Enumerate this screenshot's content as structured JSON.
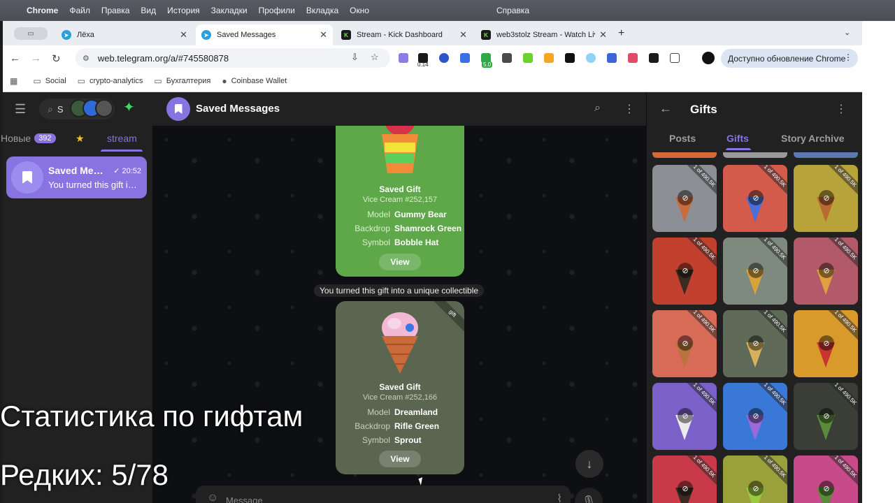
{
  "menubar": {
    "app": "Chrome",
    "items": [
      "Файл",
      "Правка",
      "Вид",
      "История",
      "Закладки",
      "Профили",
      "Вкладка",
      "Окно"
    ],
    "help": "Справка"
  },
  "browser": {
    "tabs": [
      {
        "title": "Лёха",
        "favicon": "telegram-icon"
      },
      {
        "title": "Saved Messages",
        "favicon": "telegram-icon"
      },
      {
        "title": "Stream - Kick Dashboard",
        "favicon": "kick-icon"
      },
      {
        "title": "web3stolz Stream - Watch Live",
        "favicon": "kick-icon"
      }
    ],
    "url": "web.telegram.org/a/#745580878",
    "extension_badges": [
      "0.14",
      "5.0"
    ],
    "update_button": "Доступно обновление Chrome",
    "bookmarks": [
      "Social",
      "crypto-analytics",
      "Бухгалтерия",
      "Coinbase Wallet"
    ]
  },
  "sidebar": {
    "search_value": "S",
    "folders": [
      {
        "label": "Новые",
        "badge": "392"
      },
      {
        "label": "★"
      },
      {
        "label": "stream"
      }
    ],
    "chat": {
      "name": "Saved Messages",
      "time": "20:52",
      "preview": "You turned this gift into a unique collectible"
    }
  },
  "chat": {
    "title": "Saved Messages",
    "service_message": "You turned this gift into a unique collectible",
    "composer_placeholder": "Message",
    "cards": [
      {
        "title": "Saved Gift",
        "subtitle": "Vice Cream #252,157",
        "model": "Gummy Bear",
        "backdrop": "Shamrock Green",
        "symbol": "Bobble Hat",
        "view": "View",
        "label_model": "Model",
        "label_backdrop": "Backdrop",
        "label_symbol": "Symbol",
        "accent": "#5fa84a"
      },
      {
        "title": "Saved Gift",
        "subtitle": "Vice Cream #252,166",
        "model": "Dreamland",
        "backdrop": "Rifle Green",
        "symbol": "Sprout",
        "view": "View",
        "ribbon": "gift",
        "label_model": "Model",
        "label_backdrop": "Backdrop",
        "label_symbol": "Symbol",
        "accent": "#5a6650"
      }
    ]
  },
  "gifts_panel": {
    "title": "Gifts",
    "tabs": [
      "Posts",
      "Gifts",
      "Story Archive"
    ],
    "ribbon_text": "1 of 490.5K",
    "tiles": [
      {
        "bg": "#8c8f96",
        "cone": "#c96b3a"
      },
      {
        "bg": "#d45a4c",
        "cone": "#4b6fd6"
      },
      {
        "bg": "#b8a23a",
        "cone": "#b86a32"
      },
      {
        "bg": "#c2402e",
        "cone": "#3b2a22"
      },
      {
        "bg": "#7e8a7e",
        "cone": "#d8a23a"
      },
      {
        "bg": "#b25a6a",
        "cone": "#e0a040"
      },
      {
        "bg": "#d86a58",
        "cone": "#b8743a"
      },
      {
        "bg": "#5f6a58",
        "cone": "#d7b25a"
      },
      {
        "bg": "#d89a2a",
        "cone": "#c8342e"
      },
      {
        "bg": "#7a60c8",
        "cone": "#ececec"
      },
      {
        "bg": "#3a78d8",
        "cone": "#9a6ad8"
      },
      {
        "bg": "#3a3e36",
        "cone": "#5a8a3a"
      },
      {
        "bg": "#c83a48",
        "cone": "#3a2a22"
      },
      {
        "bg": "#9aa03a",
        "cone": "#9ac840"
      },
      {
        "bg": "#c84a8a",
        "cone": "#5a8a3a"
      }
    ]
  },
  "overlay": {
    "line1": "Статистика по гифтам",
    "line2": "Редких: 5/78"
  }
}
